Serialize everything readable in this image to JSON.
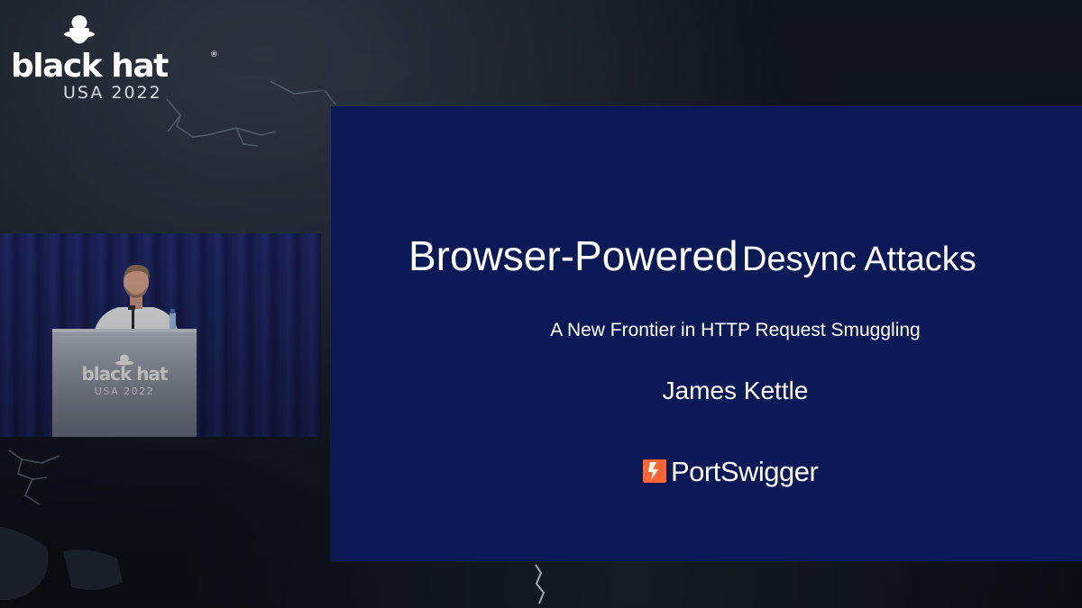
{
  "event": {
    "brand": "black hat",
    "registered_mark": "®",
    "edition": "USA 2022"
  },
  "podium": {
    "brand": "black hat",
    "edition": "USA 2022"
  },
  "slide": {
    "title_part1": "Browser-Powered",
    "title_part2": "Desync Attacks",
    "subtitle": "A New Frontier in HTTP Request Smuggling",
    "author": "James Kettle",
    "company": "PortSwigger"
  },
  "colors": {
    "slide_bg": "#0b1a57",
    "portswigger_orange": "#ff6633",
    "curtain_blue": "#1b225b"
  },
  "icons": {
    "logo_mark": "hat-silhouette-icon",
    "company_mark": "lightning-bolt-icon"
  }
}
